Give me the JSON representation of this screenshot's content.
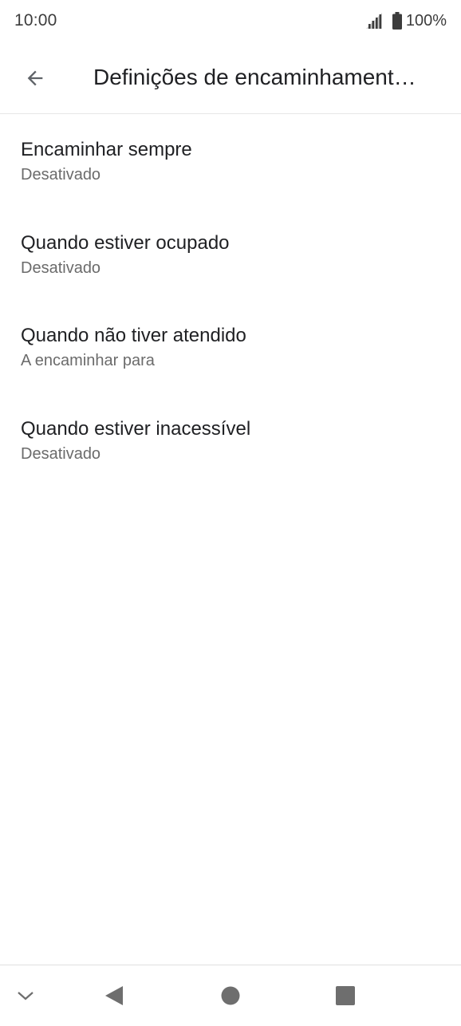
{
  "status_bar": {
    "time": "10:00",
    "battery": "100%"
  },
  "app_bar": {
    "title": "Definições de encaminhamento de chamadas",
    "back_icon": "arrow-back-icon"
  },
  "settings": {
    "items": [
      {
        "title": "Encaminhar sempre",
        "summary": "Desativado"
      },
      {
        "title": "Quando estiver ocupado",
        "summary": "Desativado"
      },
      {
        "title": "Quando não tiver atendido",
        "summary": "A encaminhar para"
      },
      {
        "title": "Quando estiver inacessível",
        "summary": "Desativado"
      }
    ]
  },
  "nav_bar": {
    "icons": [
      "chevron-down-icon",
      "back-triangle-icon",
      "home-circle-icon",
      "recents-square-icon"
    ]
  },
  "colors": {
    "primary_text": "#202124",
    "secondary_text": "#6b6b6b",
    "icon_gray": "#5f6368",
    "nav_gray": "#6e6e6e"
  }
}
